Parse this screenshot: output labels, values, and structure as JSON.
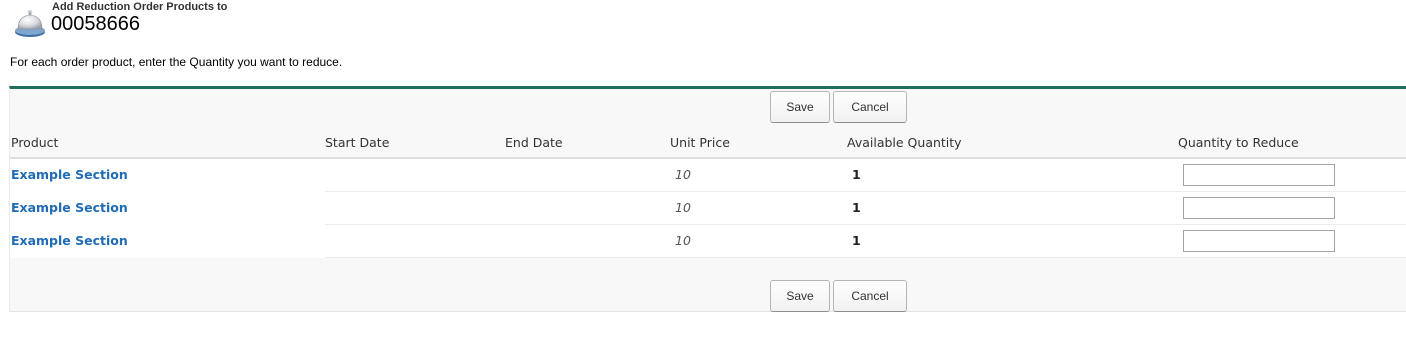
{
  "header": {
    "subtitle": "Add Reduction Order Products to",
    "title": "00058666",
    "icon": "order-bell-icon"
  },
  "instructions": "For each order product, enter the Quantity you want to reduce.",
  "buttons": {
    "save_label": "Save",
    "cancel_label": "Cancel"
  },
  "table": {
    "columns": {
      "product": "Product",
      "start_date": "Start Date",
      "end_date": "End Date",
      "unit_price": "Unit Price",
      "available_quantity": "Available Quantity",
      "quantity_to_reduce": "Quantity to Reduce"
    },
    "rows": [
      {
        "product": "Example Section",
        "start_date": "",
        "end_date": "",
        "unit_price": "10",
        "available_quantity": "1",
        "quantity_to_reduce": ""
      },
      {
        "product": "Example Section",
        "start_date": "",
        "end_date": "",
        "unit_price": "10",
        "available_quantity": "1",
        "quantity_to_reduce": ""
      },
      {
        "product": "Example Section",
        "start_date": "",
        "end_date": "",
        "unit_price": "10",
        "available_quantity": "1",
        "quantity_to_reduce": ""
      }
    ]
  },
  "colors": {
    "accent_border": "#1f6f5c",
    "link": "#1f6bb6"
  }
}
